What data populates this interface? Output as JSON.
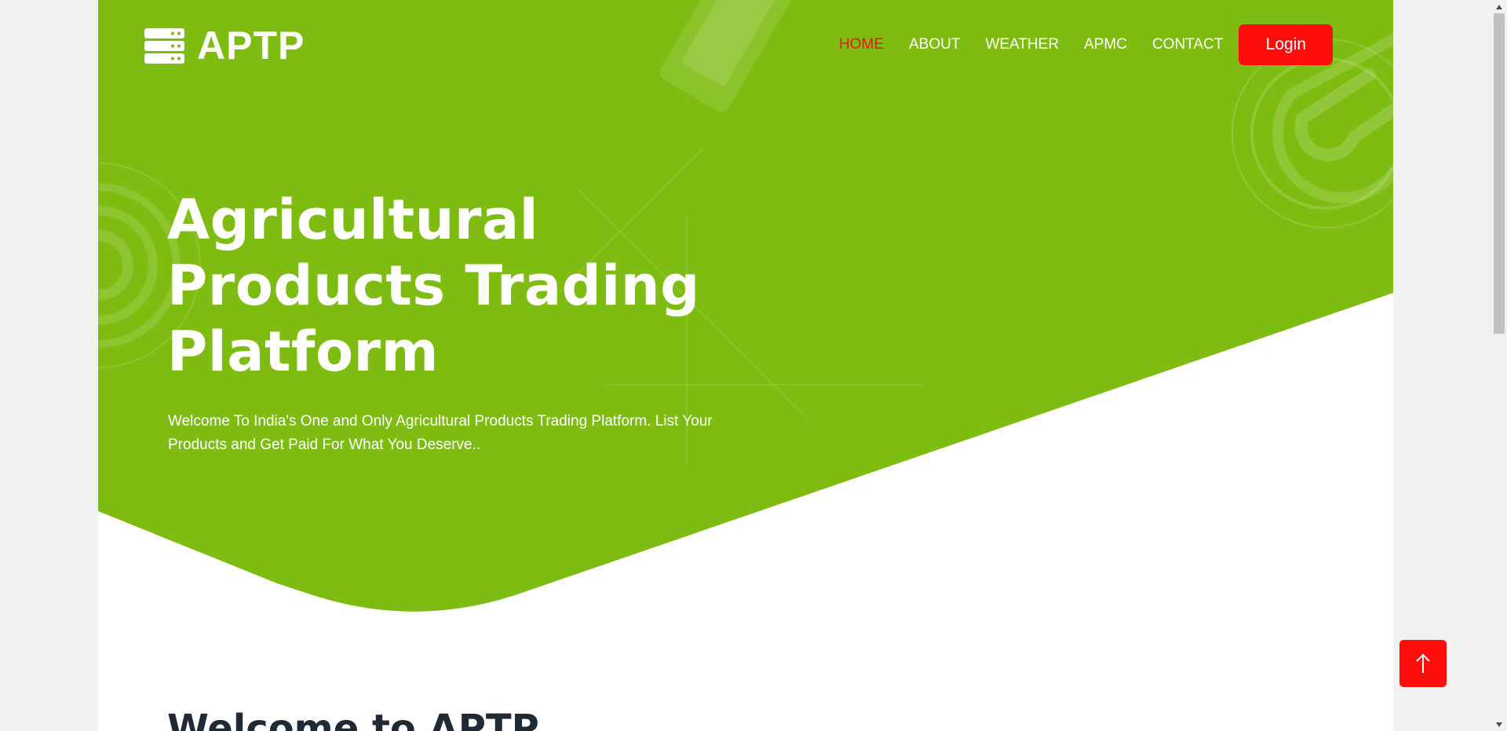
{
  "brand": {
    "name": "APTP",
    "icon": "server-stack-icon"
  },
  "nav": {
    "items": [
      {
        "label": "HOME",
        "active": true
      },
      {
        "label": "ABOUT",
        "active": false
      },
      {
        "label": "WEATHER",
        "active": false
      },
      {
        "label": "APMC",
        "active": false
      },
      {
        "label": "CONTACT",
        "active": false
      }
    ],
    "login_label": "Login"
  },
  "hero": {
    "title_lines": [
      "Agricultural",
      "Products Trading",
      "Platform"
    ],
    "subtitle": "Welcome To India's One and Only Agricultural Products Trading Platform. List Your Products and Get Paid For What You Deserve.."
  },
  "section": {
    "title": "Welcome to APTP"
  },
  "scroll_top": {
    "icon": "arrow-up-icon"
  },
  "colors": {
    "hero_green": "#7fbc12",
    "accent_red": "#ff0c0c",
    "active_nav": "#e8180f",
    "heading_dark": "#1f2a36"
  }
}
